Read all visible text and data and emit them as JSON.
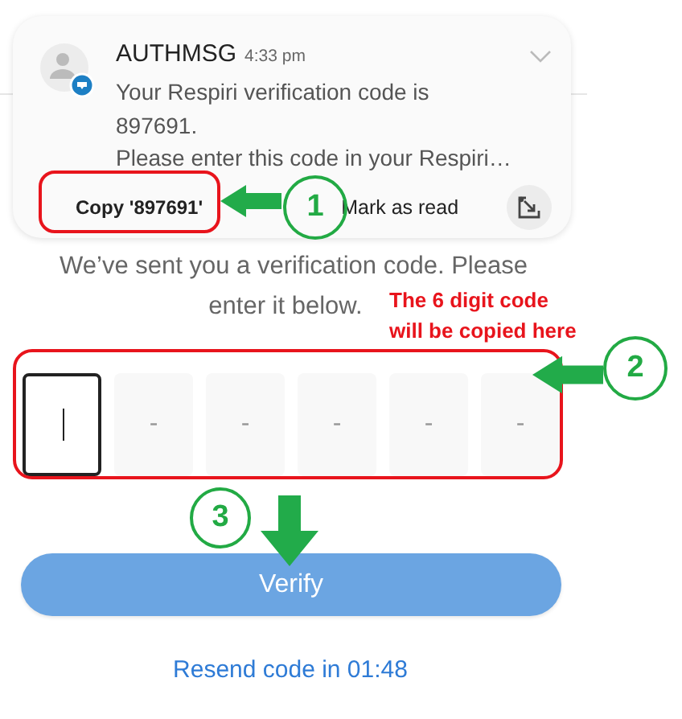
{
  "notification": {
    "sender": "AUTHMSG",
    "time": "4:33 pm",
    "body_lines": [
      "Your Respiri verification code is",
      "897691.",
      "Please enter this code in your Respiri…"
    ],
    "actions": [
      {
        "label": "Copy '897691'"
      },
      {
        "label": "Mark as read"
      }
    ]
  },
  "prompt_lines": [
    "We’ve sent you a verification code. Please",
    "enter it below."
  ],
  "code_fields": [
    {
      "selected": true
    },
    {
      "placeholder": "-",
      "selected": false
    },
    {
      "placeholder": "-",
      "selected": false
    },
    {
      "placeholder": "-",
      "selected": false
    },
    {
      "placeholder": "-",
      "selected": false
    },
    {
      "placeholder": "-",
      "selected": false
    }
  ],
  "verify_button": "Verify",
  "resend_link": "Resend code in 01:48",
  "annotations": {
    "callouts": [
      "1",
      "2",
      "3"
    ],
    "note_lines": [
      "The 6 digit code",
      "will be copied here"
    ]
  }
}
